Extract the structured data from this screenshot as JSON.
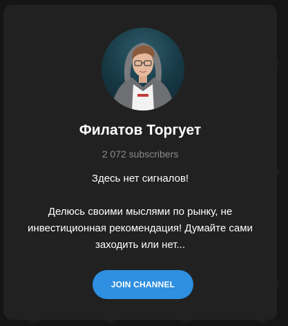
{
  "channel": {
    "title": "Филатов Торгует",
    "subscribers": "2 072 subscribers",
    "description_line1": "Здесь нет сигналов!",
    "description_line2": "Делюсь своими мыслями по рынку, не инвестиционная рекомендация! Думайте сами заходить или нет..."
  },
  "actions": {
    "join_label": "JOIN CHANNEL"
  },
  "colors": {
    "background": "#151515",
    "card": "#212121",
    "accent": "#2f8fe0",
    "subscribers_text": "#8c8c8c"
  },
  "icons": {
    "avatar": "channel-avatar-photo"
  }
}
